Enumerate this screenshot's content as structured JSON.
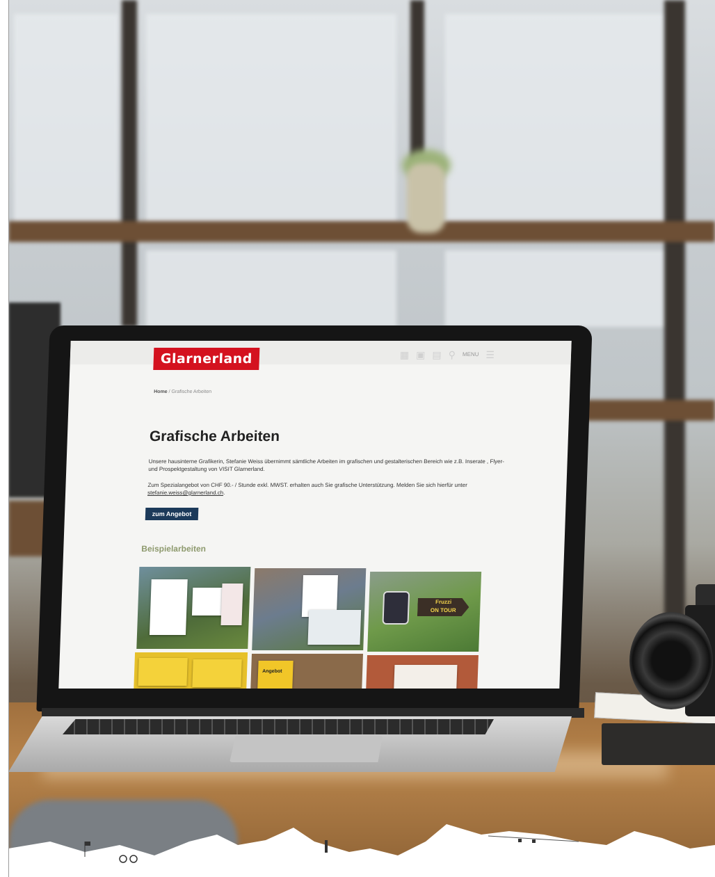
{
  "site": {
    "logo": "Glarnerland",
    "nav_menu_label": "MENU",
    "breadcrumb": {
      "home": "Home",
      "current": "Grafische Arbeiten"
    },
    "page_title": "Grafische Arbeiten",
    "intro": "Unsere hausinterne Grafikerin, Stefanie Weiss übernimmt sämtliche Arbeiten im grafischen und gestalterischen Bereich wie z.B. Inserate , Flyer- und Prospektgestaltung von VISIT Glarnerland.",
    "offer_text": "Zum Spezialangebot von CHF 90.- / Stunde exkl. MWST. erhalten auch Sie grafische Unterstützung. Melden Sie sich hierfür unter",
    "email": "stefanie.weiss@glarnerland.ch",
    "email_suffix": ".",
    "cta_label": "zum Angebot",
    "section_title": "Beispielarbeiten",
    "tile_labels": {
      "sign_top": "Fruzzi",
      "sign_bottom": "ON TOUR",
      "t5_label": "Angebot"
    }
  },
  "icons": [
    "bed-icon",
    "cart-icon",
    "map-icon",
    "search-icon",
    "menu-icon"
  ],
  "colors": {
    "brand_red": "#d4121f",
    "cta_blue": "#1c3a5a",
    "section_green": "#8e9a6e"
  }
}
